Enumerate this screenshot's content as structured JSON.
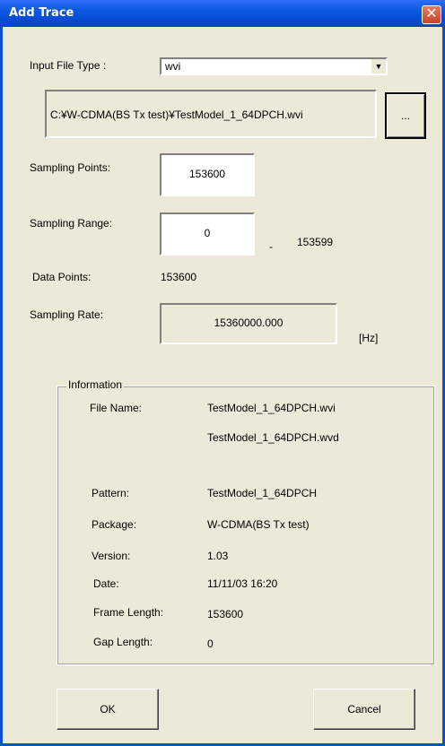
{
  "window": {
    "title": "Add Trace",
    "close_glyph": "✕"
  },
  "input_file_type": {
    "label": "Input File Type :",
    "value": "wvi",
    "arrow": "▼"
  },
  "file_path": {
    "value": "C:¥W-CDMA(BS Tx test)¥TestModel_1_64DPCH.wvi"
  },
  "browse_button": {
    "label": "..."
  },
  "sampling_points": {
    "label": "Sampling Points:",
    "value": "153600"
  },
  "sampling_range": {
    "label": "Sampling Range:",
    "start": "0",
    "separator": "-",
    "end": "153599"
  },
  "data_points": {
    "label": "Data Points:",
    "value": "153600"
  },
  "sampling_rate": {
    "label": "Sampling Rate:",
    "value": "15360000.000",
    "unit": "[Hz]"
  },
  "information": {
    "title": "Information",
    "file_name_label": "File Name:",
    "file_name_1": "TestModel_1_64DPCH.wvi",
    "file_name_2": "TestModel_1_64DPCH.wvd",
    "pattern_label": "Pattern:",
    "pattern": "TestModel_1_64DPCH",
    "package_label": "Package:",
    "package": "W-CDMA(BS Tx test)",
    "version_label": "Version:",
    "version": "1.03",
    "date_label": "Date:",
    "date": "11/11/03 16:20",
    "frame_length_label": "Frame Length:",
    "frame_length": "153600",
    "gap_length_label": "Gap Length:",
    "gap_length": "0"
  },
  "buttons": {
    "ok": "OK",
    "cancel": "Cancel"
  }
}
